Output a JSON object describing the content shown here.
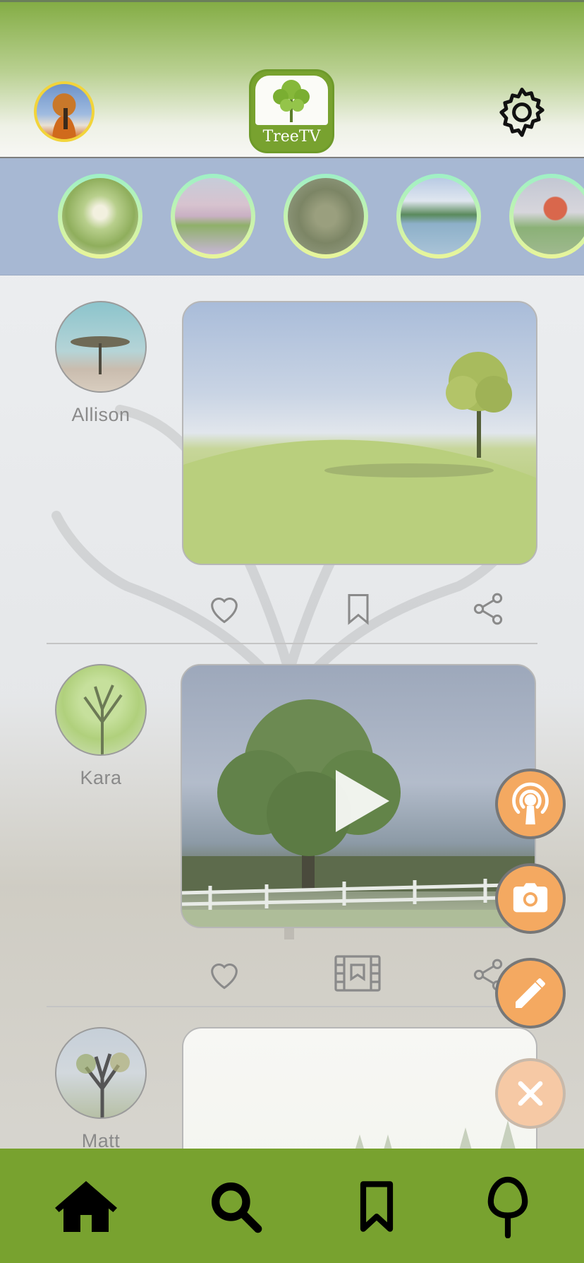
{
  "app": {
    "title": "TreeTV"
  },
  "header": {
    "profile_avatar": "user-avatar",
    "settings_icon": "gear-icon"
  },
  "stories": [
    {
      "name": "story-1"
    },
    {
      "name": "story-2"
    },
    {
      "name": "story-3"
    },
    {
      "name": "story-4"
    },
    {
      "name": "story-5"
    }
  ],
  "posts": [
    {
      "author": "Allison",
      "media_type": "image",
      "actions": [
        "heart-icon",
        "bookmark-icon",
        "share-icon"
      ]
    },
    {
      "author": "Kara",
      "media_type": "video",
      "actions": [
        "heart-icon",
        "film-icon",
        "share-icon"
      ]
    },
    {
      "author": "Matt",
      "media_type": "image",
      "actions": []
    }
  ],
  "fab_menu": [
    "podcast-icon",
    "camera-icon",
    "pencil-icon",
    "close-icon"
  ],
  "bottom_nav": [
    "home-icon",
    "search-icon",
    "bookmark-icon",
    "tree-icon"
  ],
  "colors": {
    "brand_green": "#78a22f",
    "fab_orange": "#f4a961",
    "stories_bg": "#a7b8d3"
  }
}
